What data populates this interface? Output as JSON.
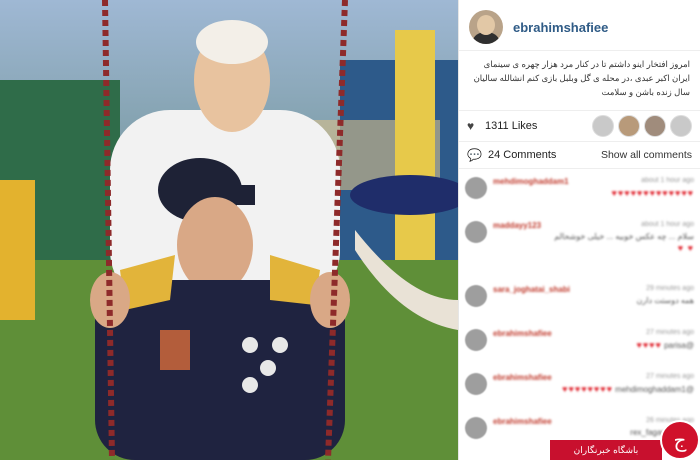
{
  "post": {
    "username": "ebrahimshafiee",
    "caption": "امروز افتخار اینو داشتم تا در کنار مرد هزار چهره ی سینمای ایران اکبر عبدی ،در محله ی گل وبلبل بازی کنم انشالله سالیان سال زنده باشن و سلامت",
    "likes": "1311 Likes",
    "comments_count": "24 Comments",
    "show_all": "Show all comments"
  },
  "comments": [
    {
      "user": "mehdimoghaddam1",
      "time": "about 1 hour ago",
      "text": "",
      "hearts": "♥♥♥♥♥♥♥♥♥♥♥♥♥"
    },
    {
      "user": "maddayy123",
      "time": "about 1 hour ago",
      "text": "سلام ... چه عکس خوبیه ... خیلی خوشحالم",
      "hearts": "♥ ♥"
    },
    {
      "user": "sara_joghatai_shabi",
      "time": "29 minutes ago",
      "text": "همه دوستت دارن",
      "hearts": ""
    },
    {
      "user": "ebrahimshafiee",
      "time": "27 minutes ago",
      "text": "@parisa",
      "hearts": "♥♥♥♥"
    },
    {
      "user": "ebrahimshafiee",
      "time": "27 minutes ago",
      "text": "@mehdimoghaddam1",
      "hearts": "♥♥♥♥♥♥♥♥"
    },
    {
      "user": "ebrahimshafiee",
      "time": "26 minutes ago",
      "text": "@rex_fagari_sara",
      "hearts": ""
    }
  ],
  "brand": {
    "text": "باشگاه خبرنگاران",
    "logo": "ج"
  },
  "colors": {
    "username": "#2f5b86",
    "comment_user": "#c0392b",
    "heart": "#e0242e",
    "brand": "#c8102e"
  }
}
